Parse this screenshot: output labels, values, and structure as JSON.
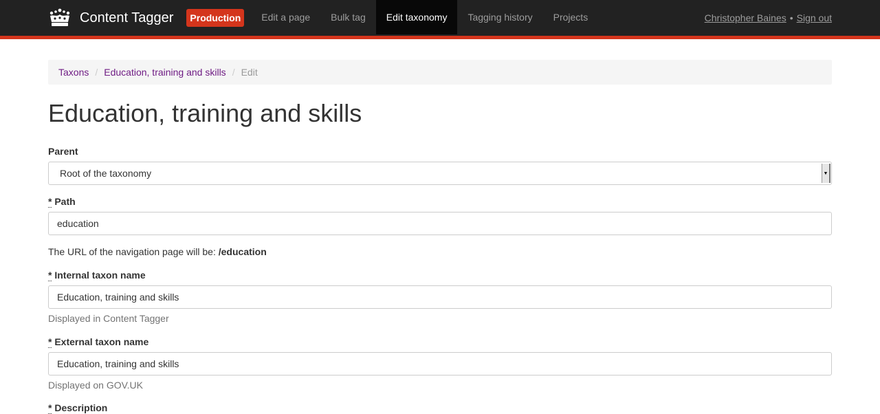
{
  "app": {
    "name": "Content Tagger",
    "environment": "Production"
  },
  "nav": {
    "items": [
      {
        "label": "Edit a page",
        "active": false
      },
      {
        "label": "Bulk tag",
        "active": false
      },
      {
        "label": "Edit taxonomy",
        "active": true
      },
      {
        "label": "Tagging history",
        "active": false
      },
      {
        "label": "Projects",
        "active": false
      }
    ],
    "user_name": "Christopher Baines",
    "separator": "•",
    "sign_out": "Sign out"
  },
  "breadcrumb": {
    "items": [
      "Taxons",
      "Education, training and skills"
    ],
    "current": "Edit",
    "separator": "/"
  },
  "page": {
    "title": "Education, training and skills"
  },
  "form": {
    "required_marker": "*",
    "parent": {
      "label": "Parent",
      "value": "Root of the taxonomy"
    },
    "path": {
      "label": "Path",
      "value": "education"
    },
    "url_note": {
      "text": "The URL of the navigation page will be:",
      "value": "/education"
    },
    "internal_name": {
      "label": "Internal taxon name",
      "value": "Education, training and skills",
      "help": "Displayed in Content Tagger"
    },
    "external_name": {
      "label": "External taxon name",
      "value": "Education, training and skills",
      "help": "Displayed on GOV.UK"
    },
    "description": {
      "label": "Description"
    }
  },
  "colors": {
    "navbar": "#222222",
    "accent": "#d4351c",
    "link": "#6f1c84"
  },
  "icons": {
    "brand": "crown-icon",
    "select": "chevron-down-icon"
  }
}
